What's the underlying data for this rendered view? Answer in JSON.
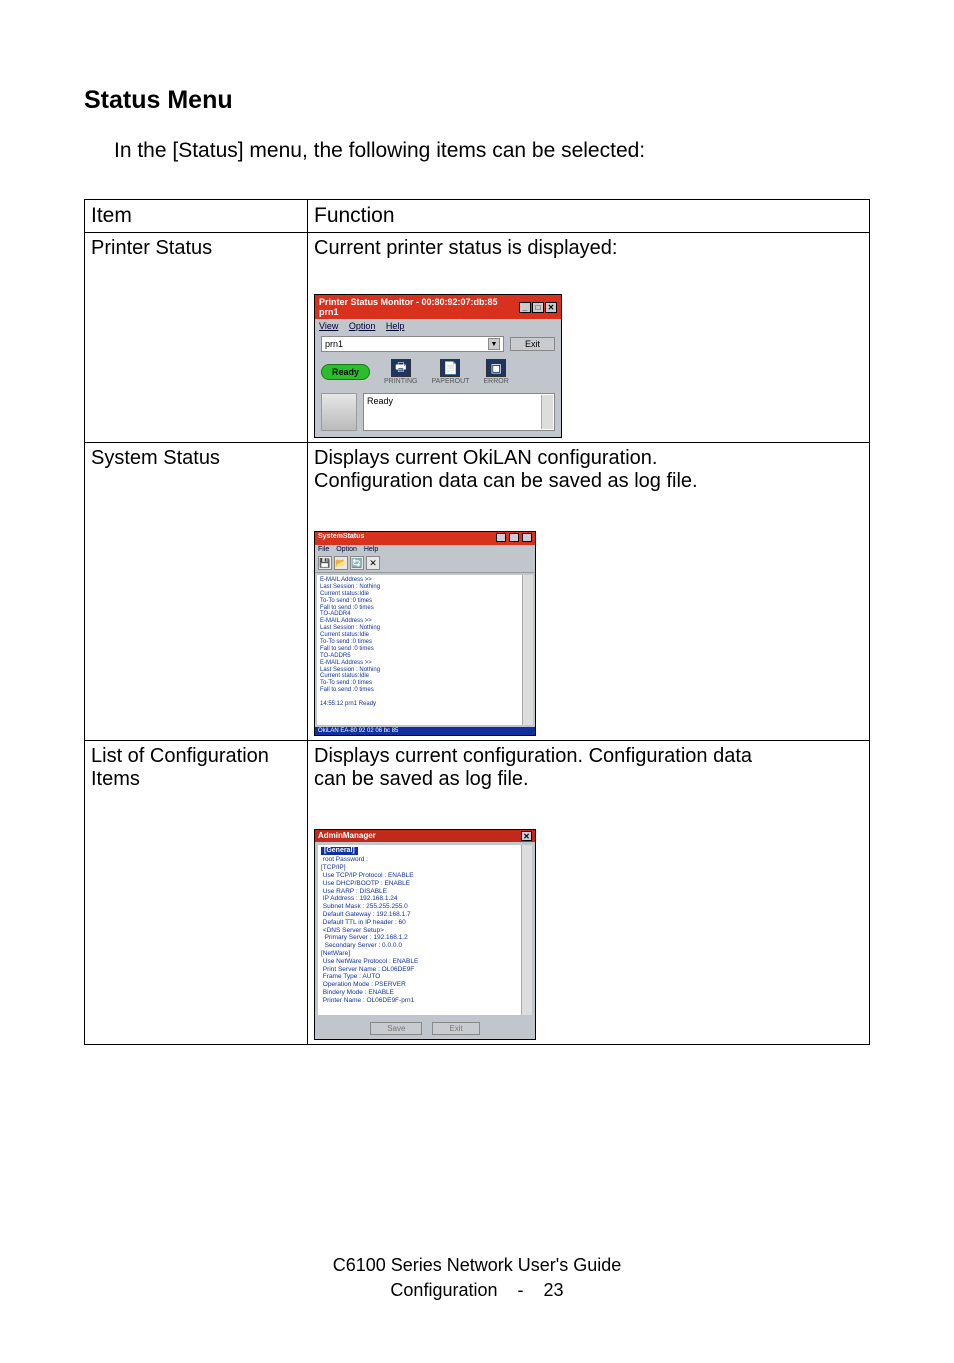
{
  "heading": "Status Menu",
  "intro": "In the [Status] menu, the following items can be selected:",
  "table": {
    "headers": {
      "item": "Item",
      "function": "Function"
    },
    "rows": [
      {
        "item": "Printer Status",
        "function_text": "Current printer status is displayed:"
      },
      {
        "item": "System Status",
        "function_text_1": "Displays current OkiLAN configuration.",
        "function_text_2": "Configuration data can be saved as log file."
      },
      {
        "item": "List of Configuration Items",
        "function_text_1": "Displays current  configuration. Configuration data",
        "function_text_2": "can be saved as log file."
      }
    ]
  },
  "psm": {
    "title": "Printer Status Monitor - 00:80:92:07:db:85 prn1",
    "menu": {
      "view": "View",
      "option": "Option",
      "help": "Help"
    },
    "select_value": "prn1",
    "exit_btn": "Exit",
    "ready": "Ready",
    "ind_printing": "PRINTING",
    "ind_paperout": "PAPEROUT",
    "ind_error": "ERROR",
    "status_text": "Ready"
  },
  "sys": {
    "title": "SystemStatus",
    "menu": {
      "file": "File",
      "option": "Option",
      "help": "Help"
    },
    "lines": [
      "E-MAIL Address >>",
      "Last Session : Nothing",
      "Current status:Idle",
      "To-To send  :0 times",
      "   Fall to send :0 times",
      "TO-ADDR4",
      "E-MAIL Address >>",
      "Last Session : Nothing",
      "Current status:Idle",
      "   To-To send  :0 times",
      "   Fall to send :0 times",
      "TO-ADDR5",
      "E-MAIL Address >>",
      "Last Session : Nothing",
      "Current status:Idle",
      "   To-To send  :0 times",
      "   Fall to send :0 times",
      "",
      "14:55:12  prn1 Ready"
    ],
    "statusbar": "OkiLAN  EA-80  92 02 06  bc 85"
  },
  "cfg": {
    "title": "AdminManager",
    "general_label": "[General]",
    "lines_general": [
      "root Password :"
    ],
    "tcpip_label": "[TCP/IP]",
    "lines_tcpip": [
      "Use TCP/IP Protocol : ENABLE",
      "Use DHCP/BOOTP : ENABLE",
      "Use RARP : DISABLE",
      "IP Address : 192.168.1.24",
      "Subnet Mask : 255.255.255.0",
      "Default Gateway : 192.168.1.7",
      "Default TTL in IP header : 60",
      "<DNS Server Setup>",
      "  Primary Server : 192.168.1.2",
      "  Secondary Server : 0.0.0.0"
    ],
    "netware_label": "[NetWare]",
    "lines_netware": [
      "Use NetWare Protocol : ENABLE",
      "Print Server Name : OL06DE9F",
      "Frame Type : AUTO",
      "Operation Mode : PSERVER",
      "Bindery Mode : ENABLE",
      "Printer Name : OL06DE9F-prn1"
    ],
    "save_btn": "Save",
    "exit_btn": "Exit"
  },
  "footer": {
    "line1": "C6100 Series Network User's Guide",
    "line2_a": "Configuration",
    "line2_b": "-",
    "line2_c": "23"
  }
}
